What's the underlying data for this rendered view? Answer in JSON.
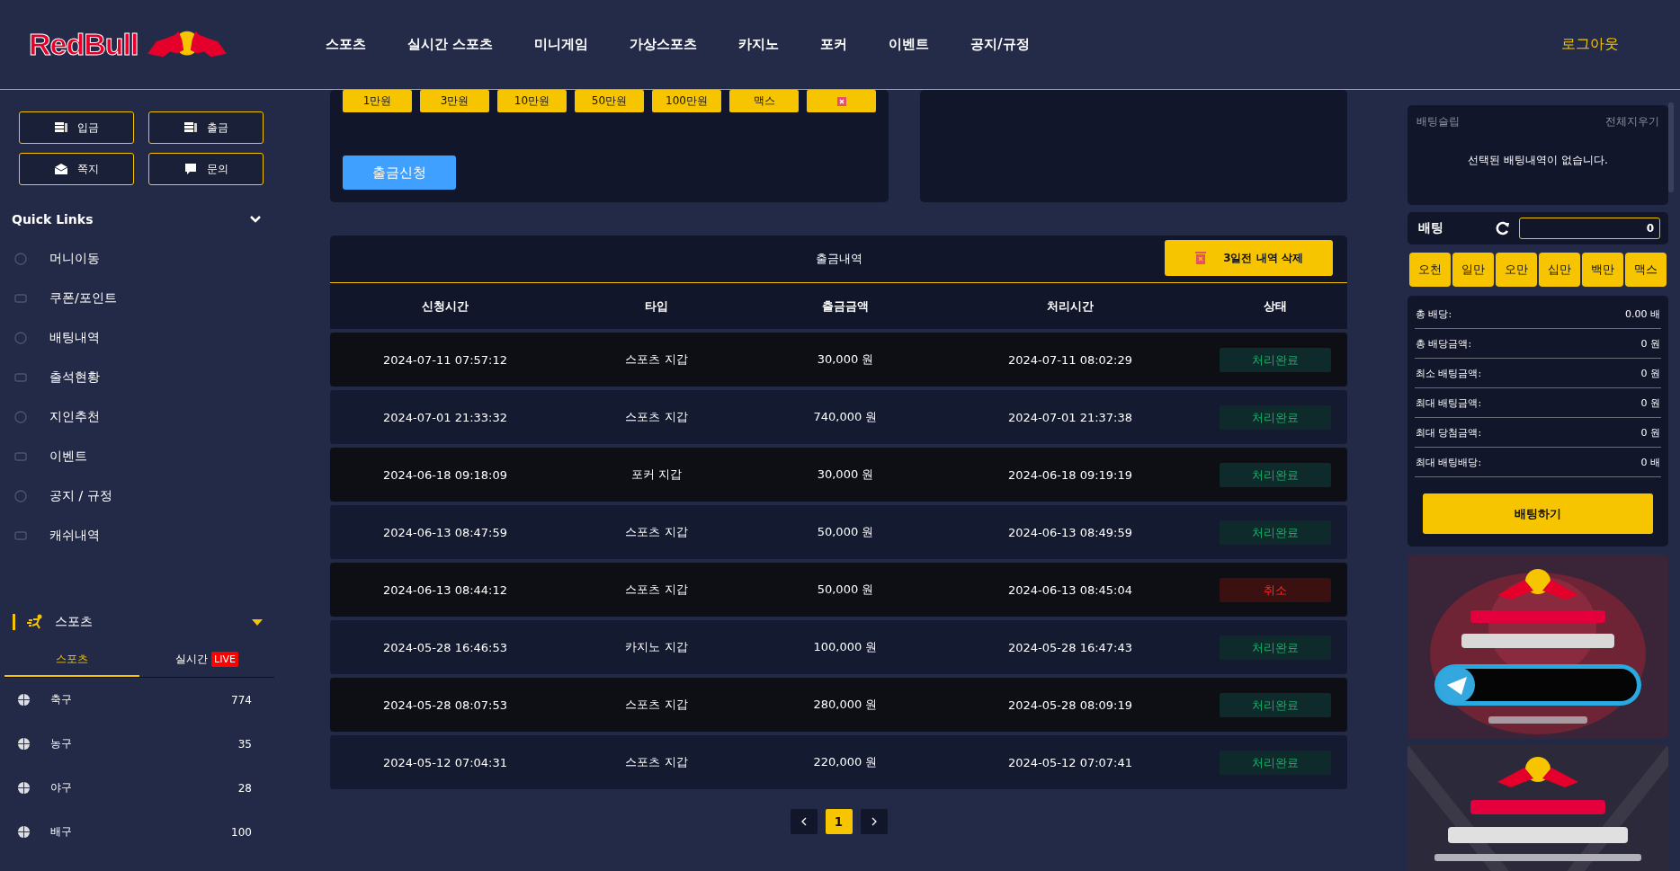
{
  "header": {
    "logo_text": "RedBull",
    "nav": [
      "스포츠",
      "실시간 스포츠",
      "미니게임",
      "가상스포츠",
      "카지노",
      "포커",
      "이벤트",
      "공지/규정"
    ],
    "logout": "로그아웃"
  },
  "sidebar": {
    "action_buttons": [
      "입금",
      "출금",
      "쪽지",
      "문의"
    ],
    "quick_links": {
      "title": "Quick Links",
      "expanded": true,
      "items": [
        "머니이동",
        "쿠폰/포인트",
        "배팅내역",
        "출석현황",
        "지인추천",
        "이벤트",
        "공지 / 규정",
        "캐쉬내역"
      ]
    },
    "sports": {
      "title": "스포츠",
      "expanded": true,
      "tabs": [
        {
          "label": "스포츠",
          "selected": true
        },
        {
          "label": "실시간",
          "selected": false,
          "badge": "LIVE"
        }
      ],
      "items": [
        {
          "name": "축구",
          "count": "774"
        },
        {
          "name": "농구",
          "count": "35"
        },
        {
          "name": "야구",
          "count": "28"
        },
        {
          "name": "배구",
          "count": "100"
        }
      ]
    }
  },
  "withdraw": {
    "chips": [
      "1만원",
      "3만원",
      "10만원",
      "50만원",
      "100만원",
      "맥스"
    ],
    "submit": "출금신청"
  },
  "history": {
    "title": "출금내역",
    "delete_button": "3일전 내역 삭제",
    "columns": [
      "신청시간",
      "타입",
      "출금금액",
      "처리시간",
      "상태"
    ],
    "rows": [
      {
        "requested": "2024-07-11 07:57:12",
        "type": "스포츠 지갑",
        "amount": "30,000 원",
        "processed": "2024-07-11 08:02:29",
        "status": "처리완료",
        "kind": "done"
      },
      {
        "requested": "2024-07-01 21:33:32",
        "type": "스포츠 지갑",
        "amount": "740,000 원",
        "processed": "2024-07-01 21:37:38",
        "status": "처리완료",
        "kind": "done"
      },
      {
        "requested": "2024-06-18 09:18:09",
        "type": "포커 지갑",
        "amount": "30,000 원",
        "processed": "2024-06-18 09:19:19",
        "status": "처리완료",
        "kind": "done"
      },
      {
        "requested": "2024-06-13 08:47:59",
        "type": "스포츠 지갑",
        "amount": "50,000 원",
        "processed": "2024-06-13 08:49:59",
        "status": "처리완료",
        "kind": "done"
      },
      {
        "requested": "2024-06-13 08:44:12",
        "type": "스포츠 지갑",
        "amount": "50,000 원",
        "processed": "2024-06-13 08:45:04",
        "status": "취소",
        "kind": "cancelled"
      },
      {
        "requested": "2024-05-28 16:46:53",
        "type": "카지노 지갑",
        "amount": "100,000 원",
        "processed": "2024-05-28 16:47:43",
        "status": "처리완료",
        "kind": "done"
      },
      {
        "requested": "2024-05-28 08:07:53",
        "type": "스포츠 지갑",
        "amount": "280,000 원",
        "processed": "2024-05-28 08:09:19",
        "status": "처리완료",
        "kind": "done"
      },
      {
        "requested": "2024-05-12 07:04:31",
        "type": "스포츠 지갑",
        "amount": "220,000 원",
        "processed": "2024-05-12 07:07:41",
        "status": "처리완료",
        "kind": "done"
      }
    ],
    "pages": [
      {
        "label": "1",
        "selected": true
      }
    ]
  },
  "betslip": {
    "title": "배팅슬립",
    "clear_all": "전체지우기",
    "empty_message": "선택된 배팅내역이 없습니다.",
    "stake_label": "배팅",
    "stake_value": "0",
    "chips": [
      "오천",
      "일만",
      "오만",
      "십만",
      "백만",
      "맥스"
    ],
    "summary": [
      {
        "label": "총 배당:",
        "value": "0.00 배"
      },
      {
        "label": "총 배당금액:",
        "value": "0 원"
      },
      {
        "label": "최소 배팅금액:",
        "value": "0 원"
      },
      {
        "label": "최대 배팅금액:",
        "value": "0 원"
      },
      {
        "label": "최대 당첨금액:",
        "value": "0 원"
      },
      {
        "label": "최대 배팅배당:",
        "value": "0 배"
      }
    ],
    "submit": "배팅하기"
  }
}
